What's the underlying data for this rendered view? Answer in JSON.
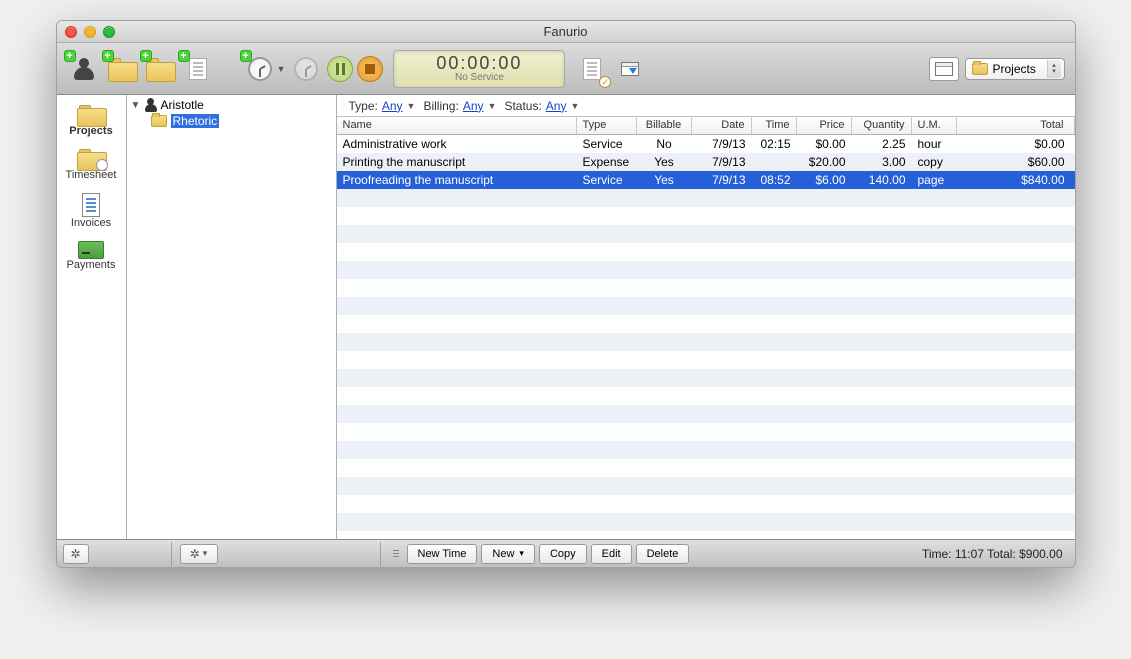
{
  "window": {
    "title": "Fanurio"
  },
  "timer": {
    "value": "00:00:00",
    "label": "No Service"
  },
  "view_selector": {
    "label": "Projects"
  },
  "sidebar": {
    "items": [
      {
        "label": "Projects"
      },
      {
        "label": "Timesheet"
      },
      {
        "label": "Invoices"
      },
      {
        "label": "Payments"
      }
    ]
  },
  "tree": {
    "client": "Aristotle",
    "project": "Rhetoric"
  },
  "filters": {
    "type_label": "Type:",
    "type_value": "Any",
    "billing_label": "Billing:",
    "billing_value": "Any",
    "status_label": "Status:",
    "status_value": "Any"
  },
  "table": {
    "headers": {
      "name": "Name",
      "type": "Type",
      "billable": "Billable",
      "date": "Date",
      "time": "Time",
      "price": "Price",
      "quantity": "Quantity",
      "um": "U.M.",
      "total": "Total"
    },
    "rows": [
      {
        "name": "Administrative work",
        "type": "Service",
        "billable": "No",
        "date": "7/9/13",
        "time": "02:15",
        "price": "$0.00",
        "quantity": "2.25",
        "um": "hour",
        "total": "$0.00"
      },
      {
        "name": "Printing the manuscript",
        "type": "Expense",
        "billable": "Yes",
        "date": "7/9/13",
        "time": "",
        "price": "$20.00",
        "quantity": "3.00",
        "um": "copy",
        "total": "$60.00"
      },
      {
        "name": "Proofreading the manuscript",
        "type": "Service",
        "billable": "Yes",
        "date": "7/9/13",
        "time": "08:52",
        "price": "$6.00",
        "quantity": "140.00",
        "um": "page",
        "total": "$840.00"
      }
    ]
  },
  "footer": {
    "buttons": {
      "new_time": "New Time",
      "new": "New",
      "copy": "Copy",
      "edit": "Edit",
      "delete": "Delete"
    },
    "summary": "Time: 11:07 Total: $900.00"
  }
}
